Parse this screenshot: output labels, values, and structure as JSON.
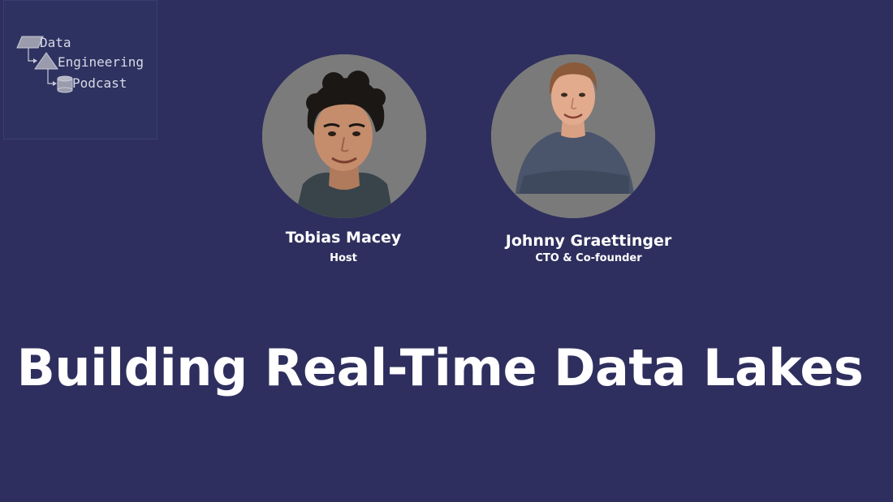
{
  "logo": {
    "line1": "Data",
    "line2": "Engineering",
    "line3": "Podcast"
  },
  "people": [
    {
      "name": "Tobias Macey",
      "role": "Host"
    },
    {
      "name": "Johnny Graettinger",
      "role": "CTO & Co-founder"
    }
  ],
  "title": "Building Real-Time Data Lakes",
  "colors": {
    "background": "#2e2f5e",
    "portrait_bg": "#7a7a7a",
    "text": "#ffffff"
  }
}
